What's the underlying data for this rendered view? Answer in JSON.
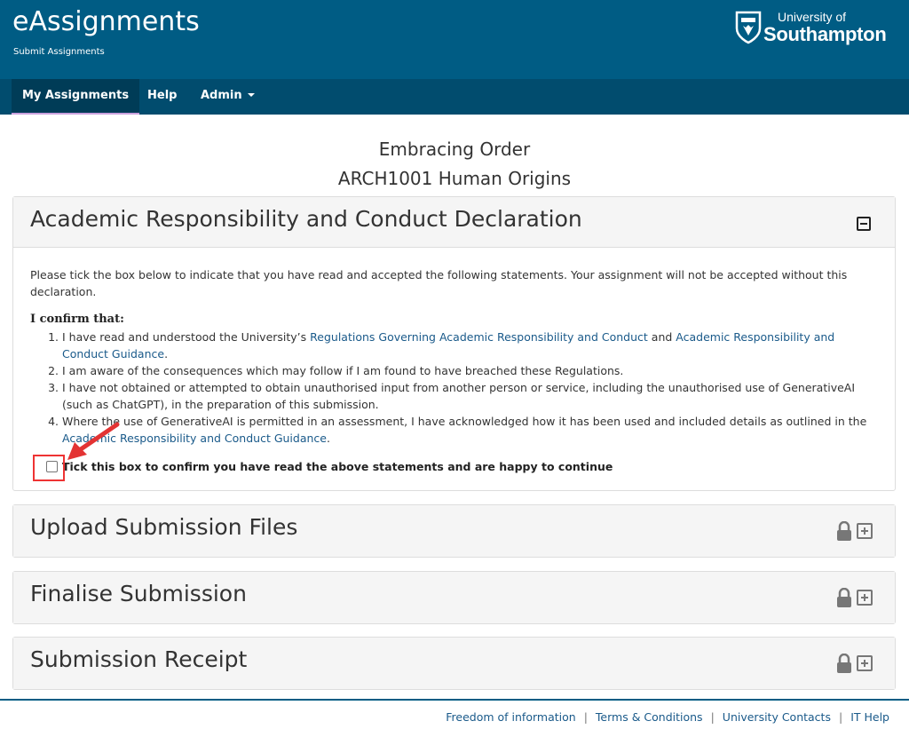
{
  "header": {
    "app_title": "eAssignments",
    "app_subtitle": "Submit Assignments",
    "logo_line1": "University of",
    "logo_line2": "Southampton"
  },
  "nav": {
    "items": [
      {
        "label": "My Assignments",
        "active": true
      },
      {
        "label": "Help"
      },
      {
        "label": "Admin"
      }
    ]
  },
  "course": {
    "title": "Embracing Order",
    "code": "ARCH1001 Human Origins"
  },
  "declaration": {
    "title": "Academic Responsibility and Conduct Declaration",
    "intro": "Please tick the box below to indicate that you have read and accepted the following statements. Your assignment will not be accepted without this declaration.",
    "confirm_heading": "I confirm that:",
    "s1_pre": "I have read and understood the University’s ",
    "s1_link1": "Regulations Governing Academic Responsibility and Conduct",
    "s1_mid": " and ",
    "s1_link2": "Academic Responsibility and Conduct Guidance",
    "s1_post": ".",
    "s2": "I am aware of the consequences which may follow if I am found to have breached these Regulations.",
    "s3": "I have not obtained or attempted to obtain unauthorised input from another person or service, including the unauthorised use of GenerativeAI (such as ChatGPT), in the preparation of this submission.",
    "s4_pre": "Where the use of GenerativeAI is permitted in an assessment, I have acknowledged how it has been used and included details as outlined in the ",
    "s4_link": "Academic Responsibility and Conduct Guidance",
    "s4_post": ".",
    "checkbox_label": "Tick this box to confirm you have read the above statements and are happy to continue"
  },
  "sections": {
    "upload": "Upload Submission Files",
    "finalise": "Finalise Submission",
    "receipt": "Submission Receipt"
  },
  "footer": {
    "links": [
      "Freedom of information",
      "Terms & Conditions",
      "University Contacts",
      "IT Help"
    ],
    "separator": "|"
  },
  "colors": {
    "header_bg": "#005c84",
    "nav_bg": "#014c6e",
    "link": "#1a5a8a",
    "annotation": "#e33333"
  }
}
